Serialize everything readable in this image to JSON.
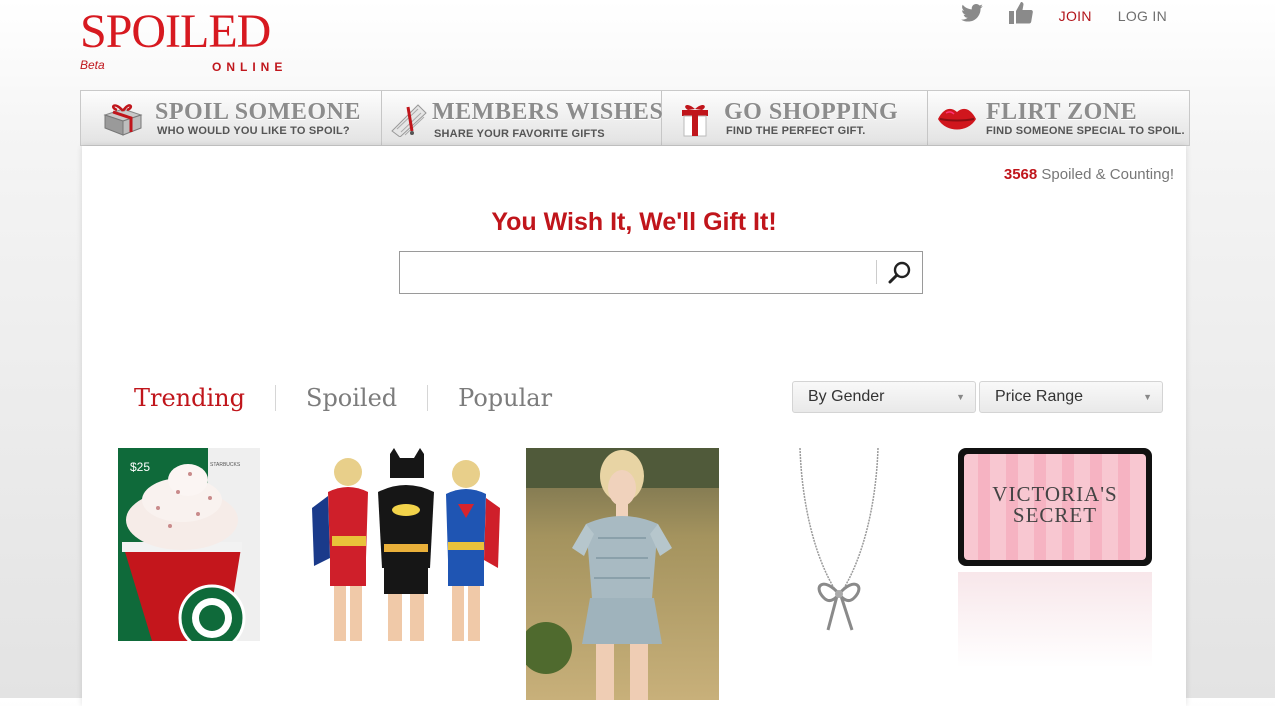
{
  "logo": {
    "text": "SPOILED",
    "beta": "Beta",
    "sub": "ONLINE"
  },
  "topnav": {
    "twitter_icon": "twitter-icon",
    "like_icon": "thumbs-up-icon",
    "join": "JOIN",
    "login": "LOG IN"
  },
  "banner": [
    {
      "title": "SPOIL SOMEONE",
      "subtitle": "WHO WOULD YOU LIKE TO SPOIL?",
      "icon": "gift-box-icon"
    },
    {
      "title": "MEMBERS WISHES",
      "subtitle": "SHARE YOUR FAVORITE GIFTS",
      "icon": "wish-list-icon"
    },
    {
      "title": "GO SHOPPING",
      "subtitle": "FIND THE PERFECT GIFT.",
      "icon": "gift-bow-icon"
    },
    {
      "title": "FLIRT ZONE",
      "subtitle": "FIND SOMEONE SPECIAL TO SPOIL.",
      "icon": "lips-icon"
    }
  ],
  "counter": {
    "count": "3568",
    "label": " Spoiled & Counting!"
  },
  "tagline": "You Wish It, We'll Gift It!",
  "search": {
    "value": "",
    "placeholder": ""
  },
  "tabs": [
    "Trending",
    "Spoiled",
    "Popular"
  ],
  "filters": {
    "gender": "By Gender",
    "price": "Price Range"
  },
  "products": {
    "starbucks_value": "$25",
    "starbucks_brand": "STARBUCKS",
    "vs_line1": "VICTORIA'S",
    "vs_line2": "SECRET"
  },
  "colors": {
    "brand_red": "#c0151b",
    "logo_red": "#d71920"
  }
}
